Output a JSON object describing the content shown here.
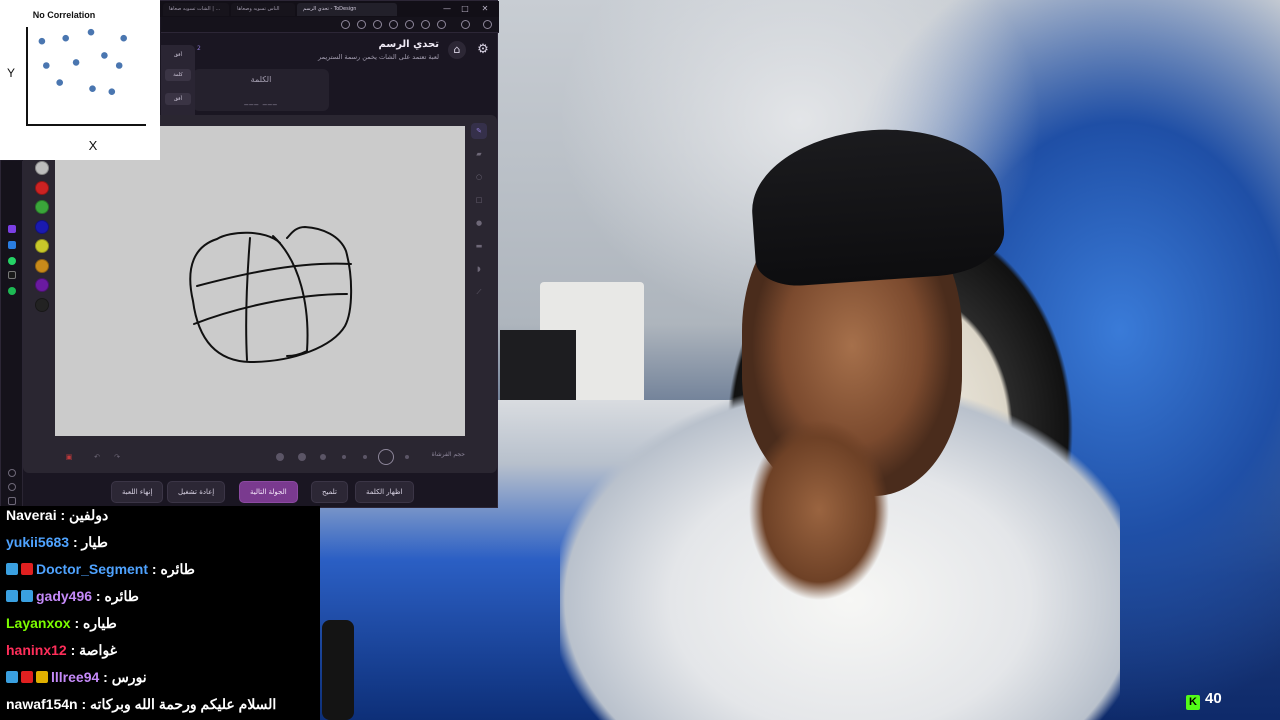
{
  "chart_overlay": {
    "chart_data": {
      "type": "scatter",
      "title": "No Correlation",
      "xlabel": "X",
      "ylabel": "Y",
      "points": [
        [
          1.0,
          8.3
        ],
        [
          2.6,
          8.6
        ],
        [
          4.3,
          9.2
        ],
        [
          6.5,
          8.6
        ],
        [
          3.3,
          6.2
        ],
        [
          5.2,
          6.9
        ],
        [
          1.3,
          5.9
        ],
        [
          6.2,
          5.9
        ],
        [
          2.2,
          4.2
        ],
        [
          4.4,
          3.6
        ],
        [
          5.7,
          3.3
        ]
      ],
      "xlim": [
        0,
        8
      ],
      "ylim": [
        0,
        11
      ],
      "point_color": "#4a76b0",
      "grid": false,
      "legend": "none"
    }
  },
  "browser": {
    "tabs": [
      "تحدي الرسم - ToDesign",
      "الناس تسويه وصعاها",
      "الشات تسويه صعاها | ..."
    ],
    "window_controls": [
      "—",
      "□",
      "✕"
    ]
  },
  "app": {
    "title": "تحدي الرسم",
    "subtitle": "لعبة تعتمد على الشات يخمن رسمة الستريمر",
    "round_indicator": "2",
    "word_card": {
      "label": "الكلمة",
      "blanks": "___ ___"
    },
    "side_popup": [
      "أفق",
      "كلمة",
      "أفق"
    ],
    "palette": [
      "#bdbdbd",
      "#cc2222",
      "#3aa63a",
      "#1a1ab0",
      "#c8c82a",
      "#c88a1a",
      "#6a1aa0",
      "#222222"
    ],
    "tools": [
      "pen-icon",
      "eraser-icon",
      "circle-icon",
      "square-icon",
      "fill-icon",
      "line-icon",
      "bucket-icon",
      "picker-icon"
    ],
    "brush_size_label": "حجم الفرشاة",
    "actions": {
      "show_word": "اظهار الكلمة",
      "hint": "تلميح",
      "next_round": "الجولة التالية",
      "restart": "إعادة تشغيل",
      "end_game": "إنهاء اللعبة"
    }
  },
  "chat": {
    "messages": [
      {
        "user": "Naverai",
        "color": "#ffffff",
        "text": "دولفين",
        "badges": []
      },
      {
        "user": "yukii5683",
        "color": "#4fa3ff",
        "text": "طيار",
        "badges": []
      },
      {
        "user": "Doctor_Segment",
        "color": "#4fa3ff",
        "text": "طائره",
        "badges": [
          "#3aa0e0",
          "#e02020"
        ]
      },
      {
        "user": "gady496",
        "color": "#c58af9",
        "text": "طائره",
        "badges": [
          "#3aa0e0",
          "#3aa0e0"
        ]
      },
      {
        "user": "Layanxox",
        "color": "#7cfc00",
        "text": "طياره",
        "badges": []
      },
      {
        "user": "haninx12",
        "color": "#ff2e5a",
        "text": "غواصة",
        "badges": []
      },
      {
        "user": "lllree94",
        "color": "#c58af9",
        "text": "نورس",
        "badges": [
          "#3aa0e0",
          "#e02020",
          "#e0b000"
        ]
      },
      {
        "user": "nawaf154n",
        "color": "#ffffff",
        "text": "السلام عليكم ورحمة الله وبركاته",
        "badges": []
      }
    ]
  },
  "viewer_count": "40"
}
